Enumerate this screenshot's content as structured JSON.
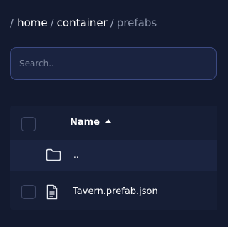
{
  "breadcrumb": {
    "root_sep": "/",
    "items": [
      "home",
      "container",
      "prefabs"
    ],
    "separator": "/"
  },
  "search": {
    "placeholder": "Search..",
    "value": ""
  },
  "table": {
    "column_name": "Name",
    "sort_direction": "ascending",
    "rows": [
      {
        "icon": "folder-icon",
        "name": ".."
      },
      {
        "icon": "file-icon",
        "name": "Tavern.prefab.json"
      }
    ]
  },
  "colors": {
    "background": "#131a2f",
    "search_border": "#3c4a82",
    "muted_text": "#8a93a8"
  }
}
